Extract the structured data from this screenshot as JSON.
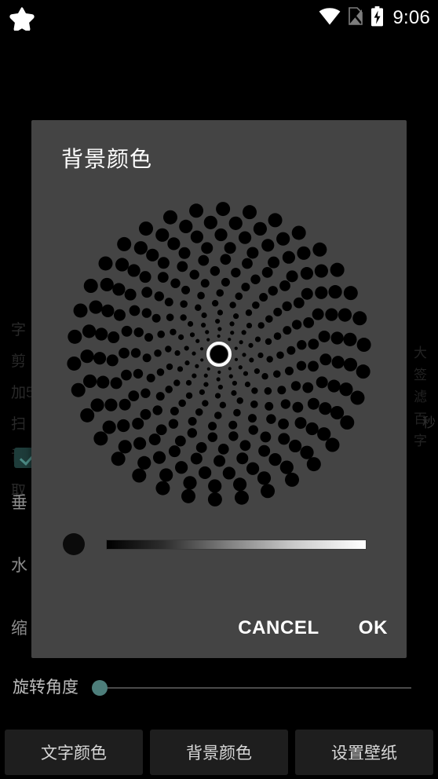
{
  "status_bar": {
    "notification_icon": "star-icon",
    "wifi_icon": "wifi-icon",
    "sim_icon": "no-sim-icon",
    "battery_icon": "battery-charging-icon",
    "time": "9:06"
  },
  "background": {
    "left_column_lines": [
      "字",
      "剪",
      "加5",
      "扫",
      "音",
      "取"
    ],
    "left_labels": [
      {
        "text": "垂",
        "top": "630"
      },
      {
        "text": "水",
        "top": "710"
      },
      {
        "text": "缩",
        "top": "790"
      }
    ],
    "right_column_lines": [
      "大",
      "签",
      "滤",
      "百",
      "字"
    ],
    "right_extra": "秒"
  },
  "rotation": {
    "label": "旋转角度",
    "thumb_color": "#4d7e7b",
    "value_position_percent": 0
  },
  "bottom_bar": {
    "buttons": [
      {
        "label": "文字颜色",
        "name": "text-color-button"
      },
      {
        "label": "背景颜色",
        "name": "background-color-button"
      },
      {
        "label": "设置壁纸",
        "name": "set-wallpaper-button"
      }
    ]
  },
  "dialog": {
    "title": "背景颜色",
    "background_color": "#444444",
    "color_wheel": {
      "name": "color-wheel-picker",
      "selected_color": "#000000",
      "selector_ring_color": "#ffffff",
      "selector_position": "center",
      "dot_color": "#000000",
      "wheel_background": "#444444"
    },
    "brightness_slider": {
      "name": "brightness-slider",
      "gradient_from": "#000000",
      "gradient_to": "#ffffff",
      "thumb_color": "#000000",
      "value_percent": 0
    },
    "actions": [
      {
        "label": "CANCEL",
        "name": "cancel-button"
      },
      {
        "label": "OK",
        "name": "ok-button"
      }
    ]
  }
}
